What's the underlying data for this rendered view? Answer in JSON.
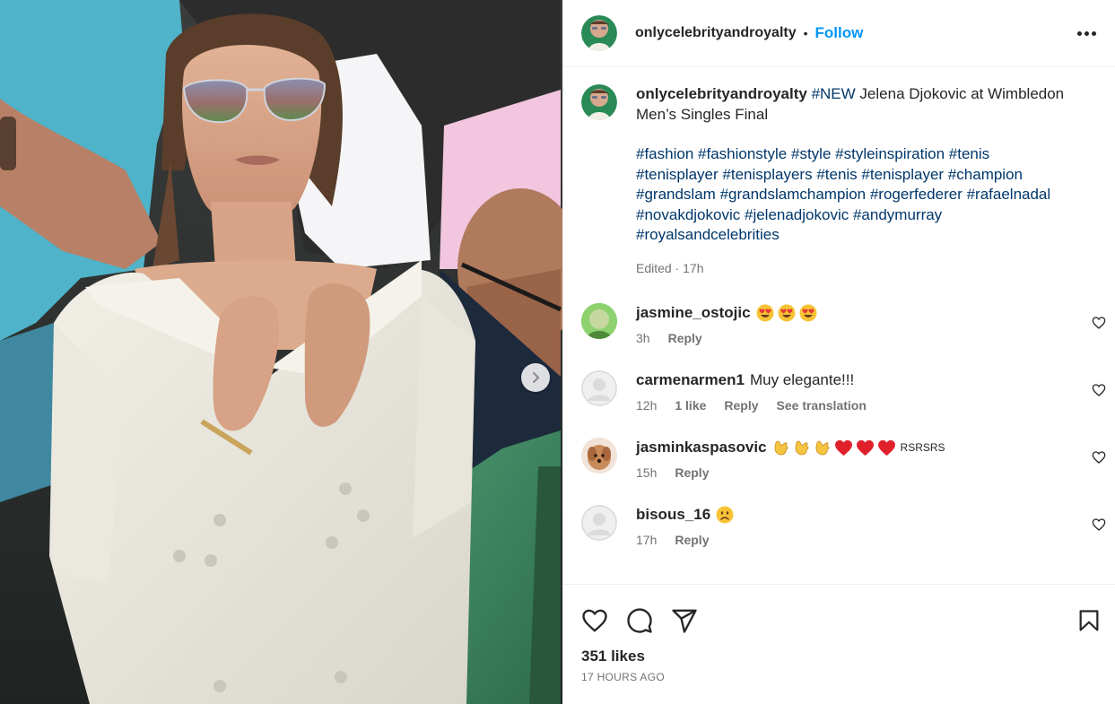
{
  "post": {
    "username": "onlycelebrityandroyalty",
    "follow_label": "Follow",
    "dot": "•",
    "more_icon": "more-horizontal-icon"
  },
  "caption": {
    "username": "onlycelebrityandroyalty",
    "hashtag_new": "#NEW",
    "text": " Jelena Djokovic at Wimbledon Men’s Singles Final",
    "hashtags": [
      "#fashion",
      "#fashionstyle",
      "#style",
      "#styleinspiration",
      "#tenis",
      "#tenisplayer",
      "#tenisplayers",
      "#tenis",
      "#tenisplayer",
      "#champion",
      "#grandslam",
      "#grandslamchampion",
      "#rogerfederer",
      "#rafaelnadal",
      "#novakdjokovic",
      "#jelenadjokovic",
      "#andymurray",
      "#royalsandcelebrities"
    ],
    "edited": "Edited · 17h"
  },
  "comments": [
    {
      "username": "jasmine_ostojic",
      "text": "",
      "emoji": "heart-eyes x3",
      "time": "3h",
      "likes": "",
      "reply": "Reply",
      "translate": ""
    },
    {
      "username": "carmenarmen1",
      "text": "Muy elegante!!!",
      "emoji": "",
      "time": "12h",
      "likes": "1 like",
      "reply": "Reply",
      "translate": "See translation"
    },
    {
      "username": "jasminkaspasovic",
      "text": "RSRSRS",
      "emoji": "clapping-hands x3, red-heart x3",
      "time": "15h",
      "likes": "",
      "reply": "Reply",
      "translate": ""
    },
    {
      "username": "bisous_16",
      "text": "",
      "emoji": "sad-face",
      "time": "17h",
      "likes": "",
      "reply": "Reply",
      "translate": ""
    }
  ],
  "actions": {
    "like_icon": "heart-icon",
    "comment_icon": "comment-icon",
    "share_icon": "send-icon",
    "save_icon": "bookmark-icon",
    "likes": "351 likes",
    "posted": "17 HOURS AGO"
  },
  "colors": {
    "accent": "#0095f6",
    "hashtag": "#00376b",
    "muted": "#737373",
    "text": "#262626"
  }
}
